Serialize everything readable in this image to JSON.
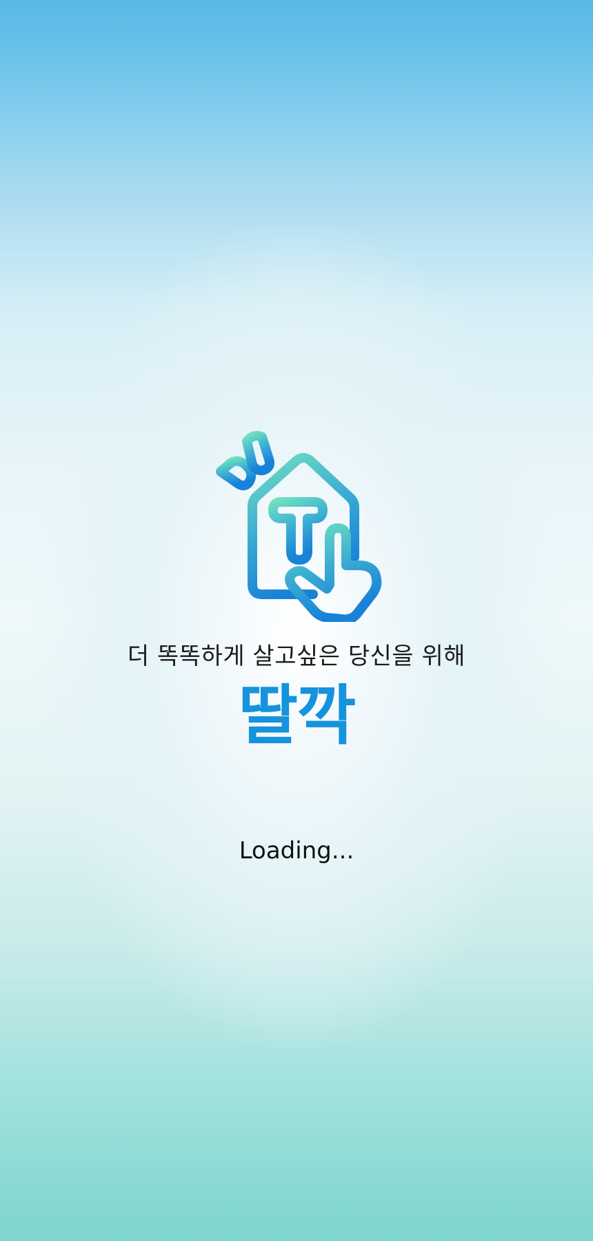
{
  "splash": {
    "tagline": "더 똑똑하게 살고싶은 당신을 위해",
    "brand_name": "딸깍",
    "loading_text": "Loading..."
  },
  "logo": {
    "icon": "house-t-tap-icon",
    "colors": {
      "gradient_top": "#6fe0c0",
      "gradient_bottom": "#1782d8"
    }
  },
  "colors": {
    "brand": "#1593dc",
    "background_top": "#58b8e6",
    "background_center": "#ffffff",
    "background_bottom": "#7dd6cf"
  }
}
